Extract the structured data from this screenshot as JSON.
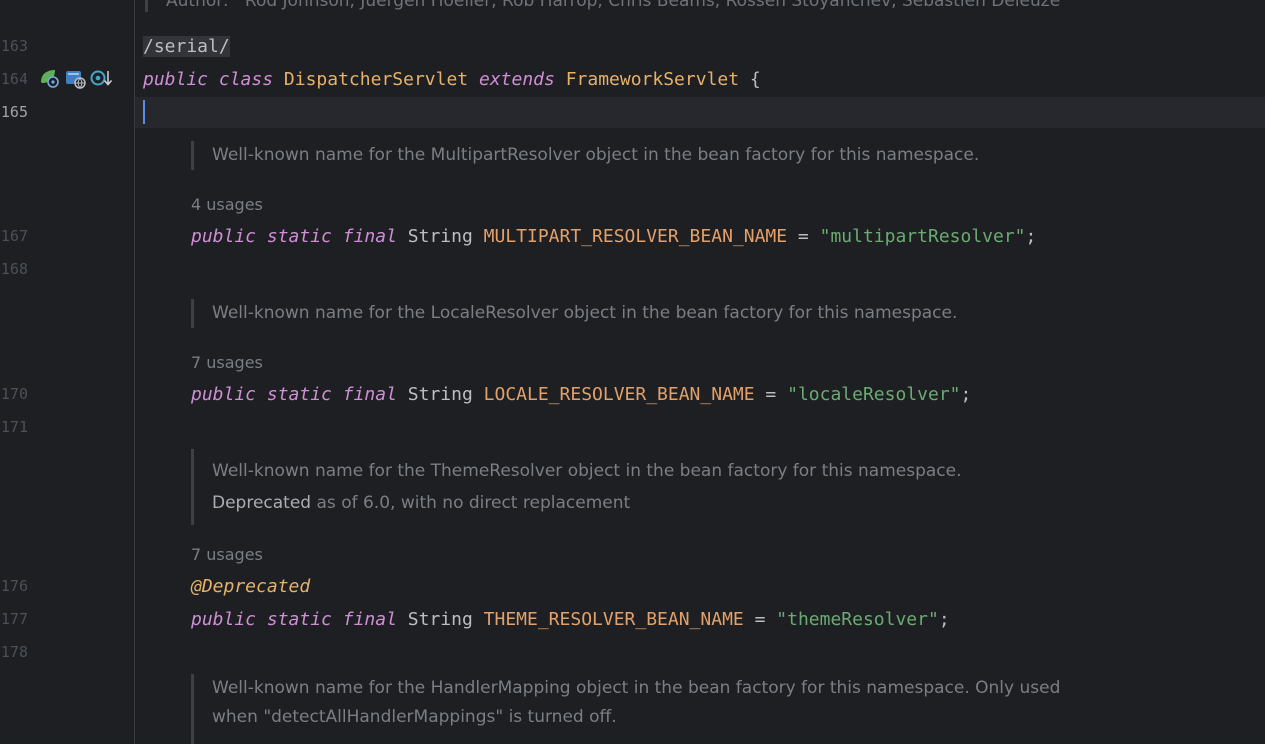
{
  "header_doc": {
    "author_label": "Author:",
    "authors": "Rod Johnson, Juergen Hoeller, Rob Harrop, Chris Beams, Rossen Stoyanchev, Sebastien Deleuze"
  },
  "line_numbers": {
    "l163": "163",
    "l164": "164",
    "l165": "165",
    "l167": "167",
    "l168": "168",
    "l170": "170",
    "l171": "171",
    "l176": "176",
    "l177": "177",
    "l178": "178"
  },
  "gutter_icons": [
    "spring-bean-icon",
    "servlet-icon",
    "implemented-override-icon"
  ],
  "code": {
    "serial": "/serial/",
    "class_decl": {
      "public": "public",
      "class": "class",
      "name": "DispatcherServlet",
      "extends": "extends",
      "parent": "FrameworkServlet",
      "brace": " {"
    },
    "kw_public": "public",
    "kw_static": "static",
    "kw_final": "final",
    "type_string": "String",
    "multipart": {
      "doc": "Well-known name for the MultipartResolver object in the bean factory for this namespace.",
      "usages": "4 usages",
      "const": "MULTIPART_RESOLVER_BEAN_NAME",
      "eq": " = ",
      "value": "\"multipartResolver\"",
      "semi": ";"
    },
    "locale": {
      "doc": "Well-known name for the LocaleResolver object in the bean factory for this namespace.",
      "usages": "7 usages",
      "const": "LOCALE_RESOLVER_BEAN_NAME",
      "eq": " = ",
      "value": "\"localeResolver\"",
      "semi": ";"
    },
    "theme": {
      "doc": "Well-known name for the ThemeResolver object in the bean factory for this namespace.",
      "deprecated_tag": "Deprecated",
      "deprecated_text": " as of 6.0, with no direct replacement",
      "usages": "7 usages",
      "annotation": "@Deprecated",
      "const": "THEME_RESOLVER_BEAN_NAME",
      "eq": " = ",
      "value": "\"themeResolver\"",
      "semi": ";"
    },
    "handler_mapping": {
      "doc_line1": "Well-known name for the HandlerMapping object in the bean factory for this namespace. Only used",
      "doc_line2": "when \"detectAllHandlerMappings\" is turned off."
    }
  },
  "colors": {
    "background": "#1e1f22",
    "keyword": "#cf8ed6",
    "class_name": "#e6b168",
    "constant": "#e2a06b",
    "string": "#6aab73",
    "caret": "#5e8ae8"
  }
}
